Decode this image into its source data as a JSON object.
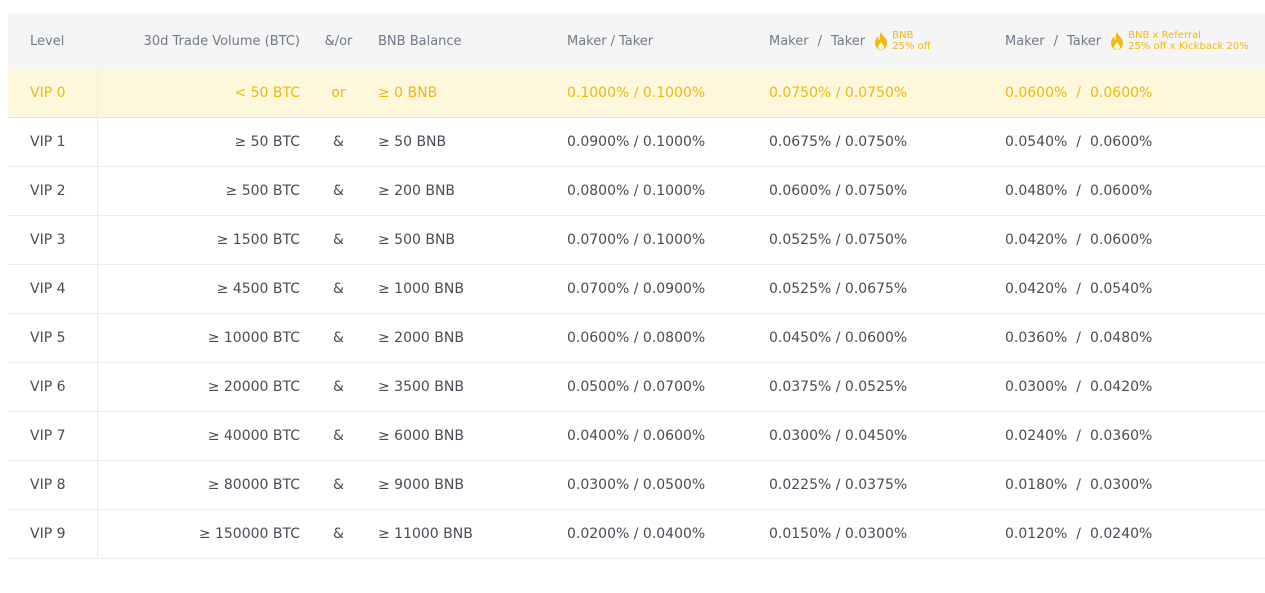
{
  "header": {
    "level": "Level",
    "volume": "30d Trade Volume (BTC)",
    "and_or": "&/or",
    "bnb_balance": "BNB Balance",
    "maker": "Maker",
    "slash": "/",
    "taker": "Taker",
    "promo_bnb_line1": "BNB",
    "promo_bnb_line2": "25% off",
    "promo_ref_line1": "BNB x Referral",
    "promo_ref_line2": "25% off x Kickback 20%"
  },
  "colors": {
    "accent": "#f0b90b",
    "highlight_row_bg": "#fdf7dc",
    "header_bg": "#f5f5f5",
    "text": "#474d57",
    "header_text": "#707a8a"
  },
  "icons": {
    "promo": "flame-icon"
  },
  "rows": [
    {
      "level": "VIP 0",
      "volume": "< 50 BTC",
      "op": "or",
      "bnb": "≥ 0 BNB",
      "mt": "0.1000% / 0.1000%",
      "mt_bnb": "0.0750% / 0.0750%",
      "ref_maker": "0.0600%",
      "ref_taker": "0.0600%"
    },
    {
      "level": "VIP 1",
      "volume": "≥ 50 BTC",
      "op": "&",
      "bnb": "≥ 50 BNB",
      "mt": "0.0900% / 0.1000%",
      "mt_bnb": "0.0675% / 0.0750%",
      "ref_maker": "0.0540%",
      "ref_taker": "0.0600%"
    },
    {
      "level": "VIP 2",
      "volume": "≥ 500 BTC",
      "op": "&",
      "bnb": "≥ 200 BNB",
      "mt": "0.0800% / 0.1000%",
      "mt_bnb": "0.0600% / 0.0750%",
      "ref_maker": "0.0480%",
      "ref_taker": "0.0600%"
    },
    {
      "level": "VIP 3",
      "volume": "≥ 1500 BTC",
      "op": "&",
      "bnb": "≥ 500 BNB",
      "mt": "0.0700% / 0.1000%",
      "mt_bnb": "0.0525% / 0.0750%",
      "ref_maker": "0.0420%",
      "ref_taker": "0.0600%"
    },
    {
      "level": "VIP 4",
      "volume": "≥ 4500 BTC",
      "op": "&",
      "bnb": "≥ 1000 BNB",
      "mt": "0.0700% / 0.0900%",
      "mt_bnb": "0.0525% / 0.0675%",
      "ref_maker": "0.0420%",
      "ref_taker": "0.0540%"
    },
    {
      "level": "VIP 5",
      "volume": "≥ 10000 BTC",
      "op": "&",
      "bnb": "≥ 2000 BNB",
      "mt": "0.0600% / 0.0800%",
      "mt_bnb": "0.0450% / 0.0600%",
      "ref_maker": "0.0360%",
      "ref_taker": "0.0480%"
    },
    {
      "level": "VIP 6",
      "volume": "≥ 20000 BTC",
      "op": "&",
      "bnb": "≥ 3500 BNB",
      "mt": "0.0500% / 0.0700%",
      "mt_bnb": "0.0375% / 0.0525%",
      "ref_maker": "0.0300%",
      "ref_taker": "0.0420%"
    },
    {
      "level": "VIP 7",
      "volume": "≥ 40000 BTC",
      "op": "&",
      "bnb": "≥ 6000 BNB",
      "mt": "0.0400% / 0.0600%",
      "mt_bnb": "0.0300% / 0.0450%",
      "ref_maker": "0.0240%",
      "ref_taker": "0.0360%"
    },
    {
      "level": "VIP 8",
      "volume": "≥ 80000 BTC",
      "op": "&",
      "bnb": "≥ 9000 BNB",
      "mt": "0.0300% / 0.0500%",
      "mt_bnb": "0.0225% / 0.0375%",
      "ref_maker": "0.0180%",
      "ref_taker": "0.0300%"
    },
    {
      "level": "VIP 9",
      "volume": "≥ 150000 BTC",
      "op": "&",
      "bnb": "≥ 11000 BNB",
      "mt": "0.0200% / 0.0400%",
      "mt_bnb": "0.0150% / 0.0300%",
      "ref_maker": "0.0120%",
      "ref_taker": "0.0240%"
    }
  ]
}
